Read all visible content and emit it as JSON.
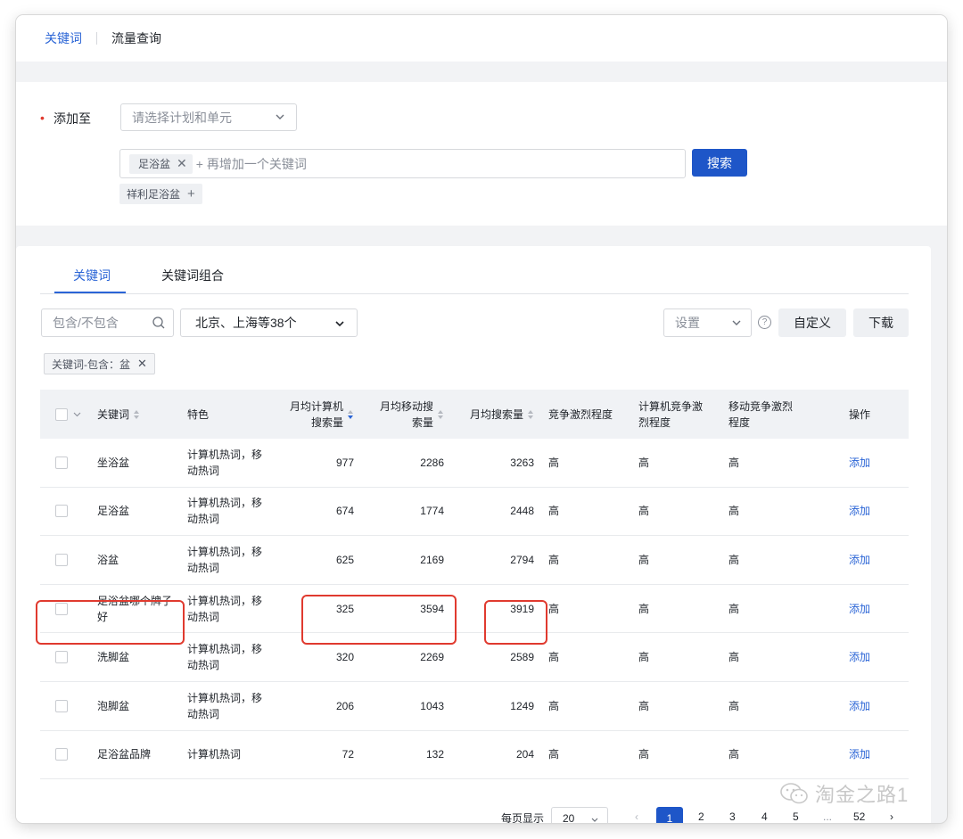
{
  "topnav": {
    "active": "关键词",
    "other": "流量查询"
  },
  "add_to": {
    "label": "添加至",
    "placeholder": "请选择计划和单元"
  },
  "keyword_input": {
    "tag": "足浴盆",
    "placeholder": "+ 再增加一个关键词"
  },
  "search_button": "搜索",
  "suggestion_tag": "祥利足浴盆",
  "tabs": [
    {
      "label": "关键词",
      "active": true
    },
    {
      "label": "关键词组合",
      "active": false
    }
  ],
  "filters": {
    "include_placeholder": "包含/不包含",
    "region": "北京、上海等38个",
    "settings": "设置",
    "custom_button": "自定义",
    "download_button": "下载",
    "chip": "关键词-包含：盆"
  },
  "table": {
    "headers": {
      "keyword": "关键词",
      "feature": "特色",
      "pc_search": [
        "月均计算机",
        "搜索量"
      ],
      "mobile_search": [
        "月均移动搜",
        "索量"
      ],
      "monthly_search": "月均搜索量",
      "competition": "竞争激烈程度",
      "pc_competition": [
        "计算机竞争激",
        "烈程度"
      ],
      "mobile_competition": [
        "移动竞争激烈",
        "程度"
      ],
      "action": "操作"
    },
    "rows": [
      {
        "keyword": "坐浴盆",
        "feature": [
          "计算机热词，移",
          "动热词"
        ],
        "pc": "977",
        "mobile": "2286",
        "total": "3263",
        "comp": "高",
        "pc_comp": "高",
        "mob_comp": "高",
        "action": "添加"
      },
      {
        "keyword": "足浴盆",
        "feature": [
          "计算机热词，移",
          "动热词"
        ],
        "pc": "674",
        "mobile": "1774",
        "total": "2448",
        "comp": "高",
        "pc_comp": "高",
        "mob_comp": "高",
        "action": "添加"
      },
      {
        "keyword": "浴盆",
        "feature": [
          "计算机热词，移",
          "动热词"
        ],
        "pc": "625",
        "mobile": "2169",
        "total": "2794",
        "comp": "高",
        "pc_comp": "高",
        "mob_comp": "高",
        "action": "添加"
      },
      {
        "keyword": "足浴盆哪个牌子好",
        "feature": [
          "计算机热词，移",
          "动热词"
        ],
        "pc": "325",
        "mobile": "3594",
        "total": "3919",
        "comp": "高",
        "pc_comp": "高",
        "mob_comp": "高",
        "action": "添加"
      },
      {
        "keyword": "洗脚盆",
        "feature": [
          "计算机热词，移",
          "动热词"
        ],
        "pc": "320",
        "mobile": "2269",
        "total": "2589",
        "comp": "高",
        "pc_comp": "高",
        "mob_comp": "高",
        "action": "添加"
      },
      {
        "keyword": "泡脚盆",
        "feature": [
          "计算机热词，移",
          "动热词"
        ],
        "pc": "206",
        "mobile": "1043",
        "total": "1249",
        "comp": "高",
        "pc_comp": "高",
        "mob_comp": "高",
        "action": "添加"
      },
      {
        "keyword": "足浴盆品牌",
        "feature": [
          "计算机热词",
          ""
        ],
        "pc": "72",
        "mobile": "132",
        "total": "204",
        "comp": "高",
        "pc_comp": "高",
        "mob_comp": "高",
        "action": "添加"
      }
    ]
  },
  "pager": {
    "per_page_label": "每页显示",
    "per_page": "20",
    "pages": [
      "1",
      "2",
      "3",
      "4",
      "5",
      "...",
      "52"
    ],
    "prev": "‹",
    "next": "›"
  },
  "watermark": "淘金之路1"
}
